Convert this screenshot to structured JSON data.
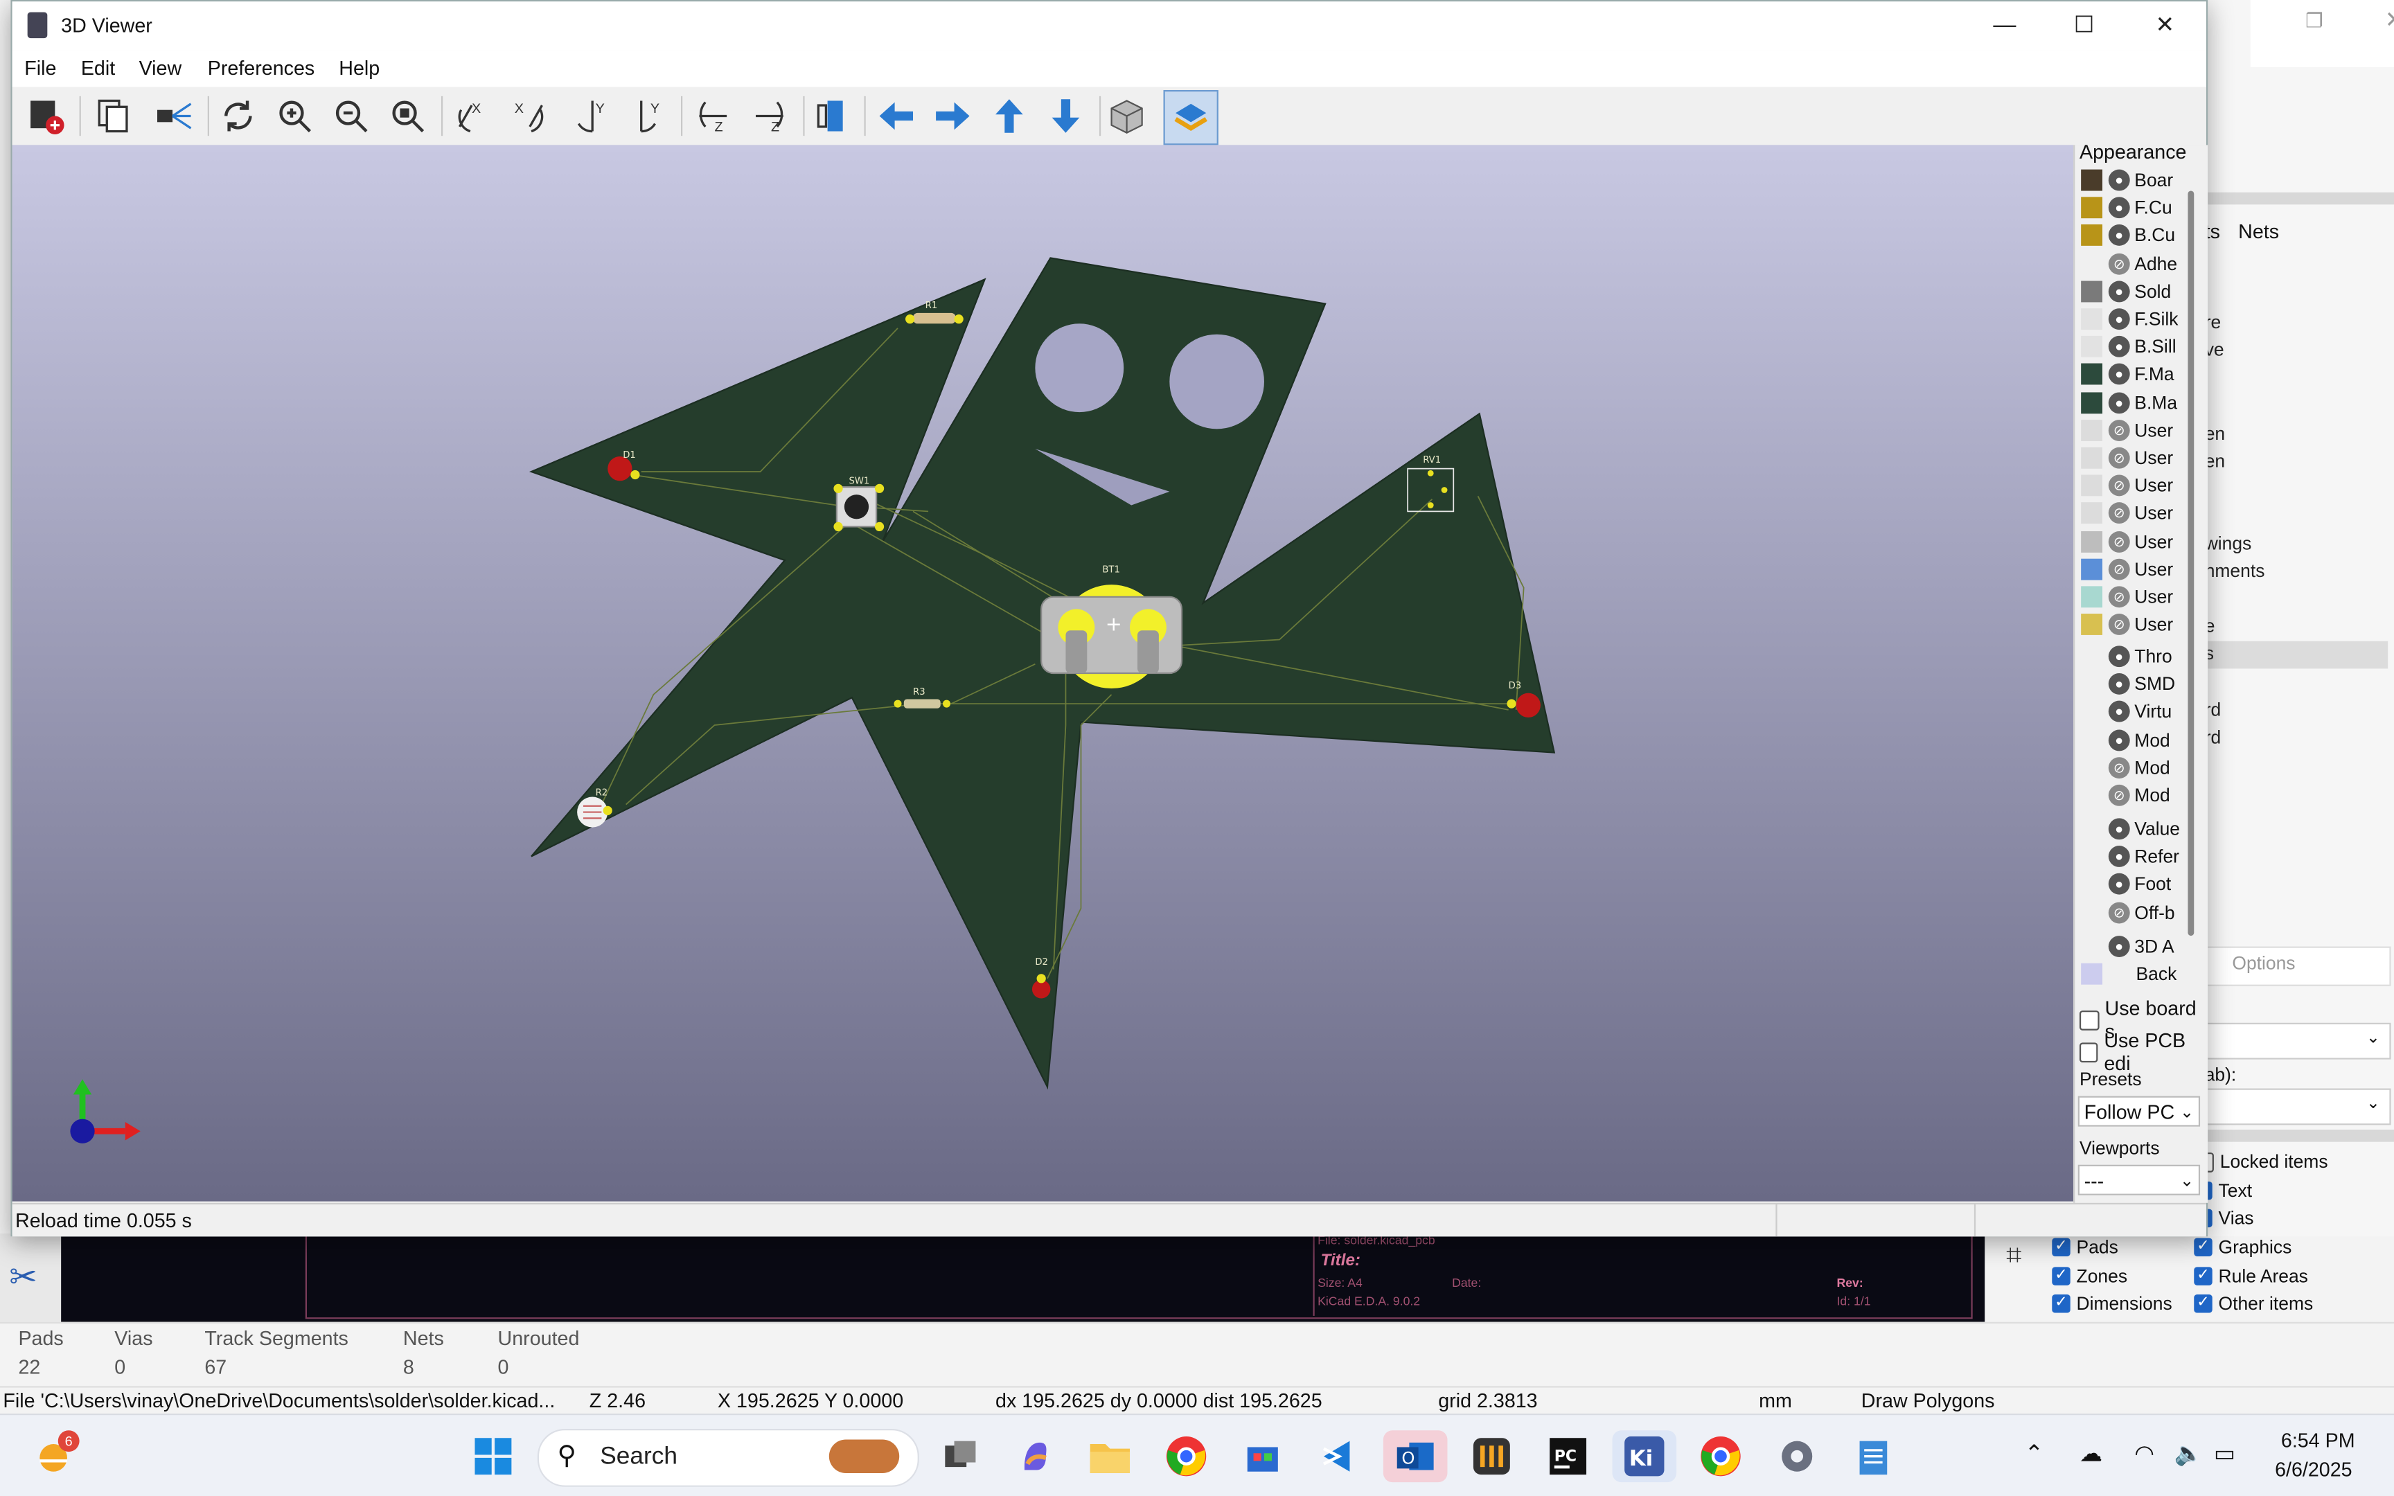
{
  "viewer": {
    "title": "3D Viewer",
    "menu": [
      "File",
      "Edit",
      "View",
      "Preferences",
      "Help"
    ],
    "toolbar_icons": [
      "render-icon",
      "copy-icon",
      "raytrace-icon",
      "reload-icon",
      "zoom-in-icon",
      "zoom-out-icon",
      "zoom-fit-icon",
      "rotate-x-cw-icon",
      "rotate-x-ccw-icon",
      "rotate-y-cw-icon",
      "rotate-y-ccw-icon",
      "rotate-z-cw-icon",
      "rotate-z-ccw-icon",
      "flip-board-icon",
      "pan-left-icon",
      "pan-right-icon",
      "pan-up-icon",
      "pan-down-icon",
      "orthographic-icon",
      "layers-icon"
    ],
    "status": "Reload time 0.055 s",
    "board_refs": [
      "R1",
      "D1",
      "SW1",
      "BT1",
      "RV1",
      "R3",
      "D3",
      "R2",
      "D2"
    ]
  },
  "appearance": {
    "title": "Appearance",
    "layers": [
      {
        "color": "#4a3c2a",
        "eye": "on",
        "label": "Boar"
      },
      {
        "color": "#b89418",
        "eye": "on",
        "label": "F.Cu"
      },
      {
        "color": "#b89418",
        "eye": "on",
        "label": "B.Cu"
      },
      {
        "color": "",
        "eye": "off",
        "label": "Adhe"
      },
      {
        "color": "#7a7a7a",
        "eye": "on",
        "label": "Sold"
      },
      {
        "color": "#e2e2e2",
        "eye": "on",
        "label": "F.Silk"
      },
      {
        "color": "#e2e2e2",
        "eye": "on",
        "label": "B.Sill"
      },
      {
        "color": "#2c4a3c",
        "eye": "on",
        "label": "F.Ma"
      },
      {
        "color": "#2c4a3c",
        "eye": "on",
        "label": "B.Ma"
      },
      {
        "color": "#dcdcdc",
        "eye": "off",
        "label": "User"
      },
      {
        "color": "#dcdcdc",
        "eye": "off",
        "label": "User"
      },
      {
        "color": "#dcdcdc",
        "eye": "off",
        "label": "User"
      },
      {
        "color": "#dcdcdc",
        "eye": "off",
        "label": "User"
      },
      {
        "color": "#bdbdbd",
        "eye": "off",
        "label": "User"
      },
      {
        "color": "#5b8fd8",
        "eye": "off",
        "label": "User"
      },
      {
        "color": "#a8d8d0",
        "eye": "off",
        "label": "User"
      },
      {
        "color": "#d8c050",
        "eye": "off",
        "label": "User"
      }
    ],
    "objects": [
      {
        "eye": "on",
        "label": "Thro"
      },
      {
        "eye": "on",
        "label": "SMD"
      },
      {
        "eye": "on",
        "label": "Virtu"
      },
      {
        "eye": "on",
        "label": "Mod"
      },
      {
        "eye": "off",
        "label": "Mod"
      },
      {
        "eye": "off",
        "label": "Mod"
      }
    ],
    "objects2": [
      {
        "eye": "on",
        "label": "Value"
      },
      {
        "eye": "on",
        "label": "Refer"
      },
      {
        "eye": "on",
        "label": "Foot"
      },
      {
        "eye": "off",
        "label": "Off-b"
      }
    ],
    "model_label": "3D A",
    "back_label": "Back",
    "back_color": "#ccccee",
    "use_board": "Use board s",
    "use_pcb": "Use PCB edi",
    "presets_label": "Presets",
    "presets_value": "Follow PC",
    "viewports_label": "Viewports",
    "viewports_value": "---"
  },
  "pcbnew_bg": {
    "tab_nets": "Nets",
    "tab_partial": "ts",
    "right_items": [
      "re",
      "ve",
      "en",
      "en",
      "wings",
      "nments",
      "l",
      "e",
      "s",
      "rd",
      "rd"
    ],
    "options_label": "Options",
    "tab_label": "ab):",
    "checks_left": [
      "Pads",
      "Zones",
      "Dimensions"
    ],
    "checks_right": [
      "Locked items",
      "Text",
      "Vias",
      "Graphics",
      "Rule Areas",
      "Other items"
    ],
    "drawsheet": {
      "file": "File: solder.kicad_pcb",
      "title": "Title:",
      "size": "Size: A4",
      "date": "Date:",
      "rev": "Rev:",
      "kicad": "KiCad E.D.A. 9.0.2",
      "id": "Id: 1/1"
    },
    "stats": {
      "headers": [
        "Pads",
        "Vias",
        "Track Segments",
        "Nets",
        "Unrouted"
      ],
      "values": [
        "22",
        "0",
        "67",
        "8",
        "0"
      ]
    },
    "status": {
      "file": "File 'C:\\Users\\vinay\\OneDrive\\Documents\\solder\\solder.kicad...",
      "z": "Z 2.46",
      "xy": "X 195.2625  Y 0.0000",
      "delta": "dx 195.2625  dy 0.0000  dist 195.2625",
      "grid": "grid 2.3813",
      "units": "mm",
      "mode": "Draw Polygons"
    }
  },
  "taskbar": {
    "search": "Search",
    "weather_badge": "6",
    "time": "6:54 PM",
    "date": "6/6/2025",
    "apps": [
      "start-icon",
      "search",
      "task-view-icon",
      "copilot-icon",
      "file-explorer-icon",
      "chrome-icon",
      "store-icon",
      "vscode-icon",
      "outlook-icon",
      "app-icon",
      "pycharm-icon",
      "kicad-icon",
      "chrome-profile-icon",
      "settings-icon",
      "notepad-icon"
    ]
  }
}
